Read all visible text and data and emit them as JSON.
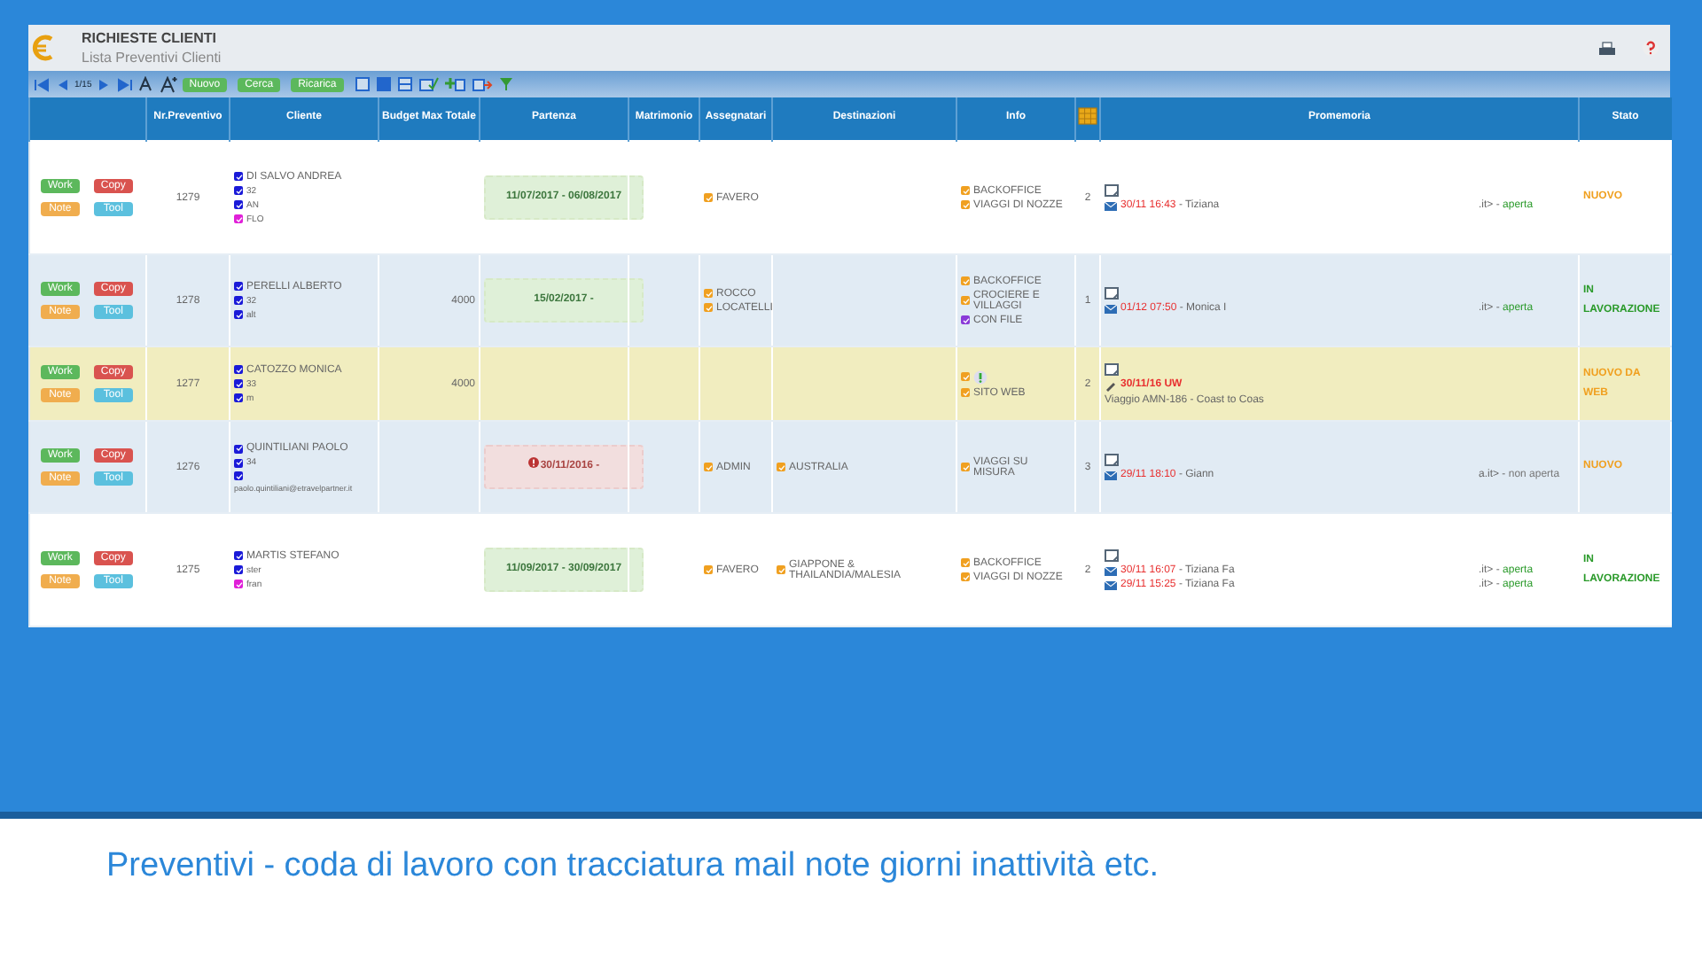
{
  "header": {
    "title": "RICHIESTE CLIENTI",
    "subtitle": "Lista Preventivi Clienti"
  },
  "toolbar": {
    "pager": "1/15",
    "buttons": [
      "Nuovo",
      "Cerca",
      "Ricarica"
    ]
  },
  "columns": [
    {
      "kind": "blank"
    },
    {
      "kind": "text",
      "label": "Nr.Preventivo"
    },
    {
      "kind": "text",
      "label": "Cliente"
    },
    {
      "kind": "text",
      "label": "Budget Max Totale"
    },
    {
      "kind": "text",
      "label": "Partenza"
    },
    {
      "kind": "text",
      "label": "Matrimonio"
    },
    {
      "kind": "text",
      "label": "Assegnatari"
    },
    {
      "kind": "text",
      "label": "Destinazioni"
    },
    {
      "kind": "text",
      "label": "Info"
    },
    {
      "kind": "calendar"
    },
    {
      "kind": "text",
      "label": "Promemoria"
    },
    {
      "kind": "text",
      "label": "Stato"
    }
  ],
  "rows": [
    {
      "color": "#ffffff",
      "actions": [
        {
          "kind": "work",
          "label": "Work"
        },
        {
          "kind": "copy",
          "label": "Copy"
        },
        {
          "kind": "note",
          "label": "Note"
        },
        {
          "kind": "tool",
          "label": "Tool"
        }
      ],
      "number": "1279",
      "client": [
        {
          "text": "DI SALVO ANDREA",
          "color": "#1a1ad8"
        },
        {
          "text": "32",
          "color": "#1a1ad8"
        },
        {
          "text": "AN",
          "color": "#1a1ad8"
        },
        {
          "text": "FLO",
          "color": "#e020d8"
        }
      ],
      "partenza": {
        "kind": "ok",
        "text": "11/07/2017 - 06/08/2017"
      },
      "assegnatari": [
        "FAVERO"
      ],
      "destinazioni": [],
      "info": [
        {
          "kind": "text",
          "text": "BACKOFFICE",
          "color": "#f0a020"
        },
        {
          "kind": "text",
          "text": "VIAGGI DI NOZZE",
          "color": "#f0a020"
        }
      ],
      "count": "2",
      "promemoria": [
        {
          "kind": "mail",
          "date": "30/11 16:43",
          "name": "- Tiziana",
          "address": ".it> -",
          "status": "aperta",
          "opened": true
        }
      ],
      "stato": {
        "kind": "new",
        "text": "NUOVO"
      }
    },
    {
      "color": "#e1ebf4",
      "actions": [
        {
          "kind": "work",
          "label": "Work"
        },
        {
          "kind": "copy",
          "label": "Copy"
        },
        {
          "kind": "note",
          "label": "Note"
        },
        {
          "kind": "tool",
          "label": "Tool"
        }
      ],
      "number": "1278",
      "client": [
        {
          "text": "PERELLI ALBERTO",
          "color": "#1a1ad8"
        },
        {
          "text": "32",
          "color": "#1a1ad8"
        },
        {
          "text": "alt",
          "color": "#1a1ad8"
        }
      ],
      "budget": "4000",
      "partenza": {
        "kind": "ok",
        "text": "15/02/2017 -"
      },
      "assegnatari": [
        "ROCCO",
        "LOCATELLI"
      ],
      "destinazioni": [],
      "info": [
        {
          "kind": "text",
          "text": "BACKOFFICE",
          "color": "#f0a020"
        },
        {
          "kind": "text",
          "text": "CROCIERE E VILLAGGI",
          "color": "#f0a020"
        },
        {
          "kind": "text",
          "text": "CON FILE",
          "color": "#8a3ad8"
        }
      ],
      "count": "1",
      "promemoria": [
        {
          "kind": "mail",
          "date": "01/12 07:50",
          "name": "- Monica I",
          "address": ".it> -",
          "status": "aperta",
          "opened": true
        }
      ],
      "stato": {
        "kind": "working",
        "text": "IN LAVORAZIONE"
      }
    },
    {
      "color": "#f1edbf",
      "actions": [
        {
          "kind": "work",
          "label": "Work"
        },
        {
          "kind": "copy",
          "label": "Copy"
        },
        {
          "kind": "note",
          "label": "Note"
        },
        {
          "kind": "tool",
          "label": "Tool"
        }
      ],
      "number": "1277",
      "client": [
        {
          "text": "CATOZZO MONICA",
          "color": "#1a1ad8"
        },
        {
          "text": "33",
          "color": "#1a1ad8"
        },
        {
          "text": "m",
          "color": "#1a1ad8"
        }
      ],
      "budget": "4000",
      "assegnatari": [],
      "destinazioni": [],
      "info": [
        {
          "kind": "icon",
          "color": "#f0a020"
        },
        {
          "kind": "text",
          "text": "SITO WEB",
          "color": "#f0a020"
        }
      ],
      "count": "2",
      "promemoria": [
        {
          "kind": "note",
          "date": "30/11/16 UW"
        },
        {
          "kind": "text",
          "text": "Viaggio AMN-186 - Coast to Coas"
        }
      ],
      "stato": {
        "kind": "new",
        "text": "NUOVO DA WEB"
      }
    },
    {
      "color": "#e1ebf4",
      "actions": [
        {
          "kind": "work",
          "label": "Work"
        },
        {
          "kind": "copy",
          "label": "Copy"
        },
        {
          "kind": "note",
          "label": "Note"
        },
        {
          "kind": "tool",
          "label": "Tool"
        }
      ],
      "number": "1276",
      "client": [
        {
          "text": "QUINTILIANI PAOLO",
          "color": "#1a1ad8"
        },
        {
          "text": "34",
          "color": "#1a1ad8"
        },
        {
          "color": "#1a1ad8"
        }
      ],
      "email": "paolo.quintiliani@etravelpartner.it",
      "partenza": {
        "kind": "late",
        "text": "30/11/2016 -"
      },
      "assegnatari": [
        "ADMIN"
      ],
      "destinazioni": [
        "AUSTRALIA"
      ],
      "info": [
        {
          "kind": "text",
          "text": "VIAGGI SU MISURA",
          "color": "#f0a020"
        }
      ],
      "count": "3",
      "promemoria": [
        {
          "kind": "mail",
          "date": "29/11 18:10",
          "name": "- Giann",
          "address": "a.it> -",
          "status": "non aperta",
          "opened": false
        }
      ],
      "stato": {
        "kind": "new",
        "text": "NUOVO"
      }
    },
    {
      "color": "#ffffff",
      "actions": [
        {
          "kind": "work",
          "label": "Work"
        },
        {
          "kind": "copy",
          "label": "Copy"
        },
        {
          "kind": "note",
          "label": "Note"
        },
        {
          "kind": "tool",
          "label": "Tool"
        }
      ],
      "number": "1275",
      "client": [
        {
          "text": "MARTIS STEFANO",
          "color": "#1a1ad8"
        },
        {
          "text": "ster",
          "color": "#1a1ad8"
        },
        {
          "text": "fran",
          "color": "#e020d8"
        }
      ],
      "partenza": {
        "kind": "ok",
        "text": "11/09/2017 - 30/09/2017"
      },
      "assegnatari": [
        "FAVERO"
      ],
      "destinazioni": [
        "GIAPPONE & THAILANDIA/MALESIA"
      ],
      "info": [
        {
          "kind": "text",
          "text": "BACKOFFICE",
          "color": "#f0a020"
        },
        {
          "kind": "text",
          "text": "VIAGGI DI NOZZE",
          "color": "#f0a020"
        }
      ],
      "count": "2",
      "promemoria": [
        {
          "kind": "mail",
          "date": "30/11 16:07",
          "name": "- Tiziana Fa",
          "address": ".it> -",
          "status": "aperta",
          "opened": true
        },
        {
          "kind": "mail",
          "date": "29/11 15:25",
          "name": "- Tiziana Fa",
          "address": ".it> -",
          "status": "aperta",
          "opened": true
        }
      ],
      "stato": {
        "kind": "working",
        "text": "IN LAVORAZIONE"
      }
    }
  ],
  "caption": "Preventivi - coda di lavoro con tracciatura mail note giorni inattività etc."
}
